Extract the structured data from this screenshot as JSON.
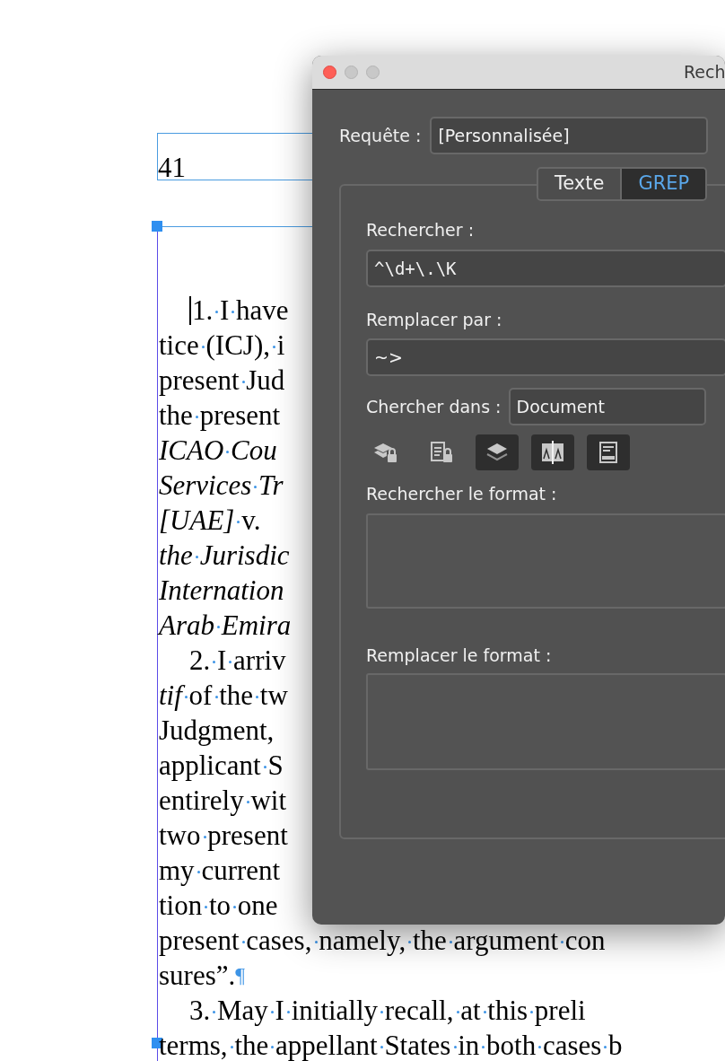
{
  "document": {
    "page_number": "41",
    "lines": [
      {
        "text": "1. I have",
        "indent": true,
        "italic": false,
        "cursor": true
      },
      {
        "text": "tice (ICJ), i",
        "indent": false,
        "italic": false
      },
      {
        "text": "present Jud",
        "indent": false,
        "italic": false
      },
      {
        "text": "the present",
        "indent": false,
        "italic": false
      },
      {
        "text": "ICAO Cou",
        "indent": false,
        "italic": true
      },
      {
        "text": "Services Tr",
        "indent": false,
        "italic": true
      },
      {
        "text": "*[UAE]* v.",
        "indent": false,
        "italic": false
      },
      {
        "text": "the Jurisdic",
        "indent": false,
        "italic": true
      },
      {
        "text": "Internation",
        "indent": false,
        "italic": true
      },
      {
        "text": "Arab Emira",
        "indent": false,
        "italic": true
      },
      {
        "text": "2. I arriv",
        "indent": true,
        "italic": false
      },
      {
        "text": "*tif* of the tw",
        "indent": false,
        "italic": false
      },
      {
        "text": "Judgment,",
        "indent": false,
        "italic": false
      },
      {
        "text": "applicant S",
        "indent": false,
        "italic": false
      },
      {
        "text": "entirely wit",
        "indent": false,
        "italic": false
      },
      {
        "text": "two present",
        "indent": false,
        "italic": false
      },
      {
        "text": "my current",
        "indent": false,
        "italic": false
      },
      {
        "text": "tion to one",
        "indent": false,
        "italic": false
      },
      {
        "text": "present cases, namely, the argument con",
        "indent": false,
        "italic": false
      },
      {
        "text": "sures”.",
        "indent": false,
        "italic": false,
        "end_mark": "¶"
      },
      {
        "text": "3. May I initially recall, at this preli",
        "indent": true,
        "italic": false
      },
      {
        "text": "terms, the appellant States in both cases b",
        "indent": false,
        "italic": false
      }
    ]
  },
  "dialog": {
    "title": "Rech",
    "query_label": "Requête :",
    "query_value": "[Personnalisée]",
    "tabs": [
      {
        "label": "Texte",
        "selected": false
      },
      {
        "label": "GREP",
        "selected": true
      }
    ],
    "find_label": "Rechercher :",
    "find_value": "^\\d+\\.\\K",
    "replace_label": "Remplacer par :",
    "replace_value": "~>",
    "search_in_label": "Chercher dans :",
    "search_in_value": "Document",
    "options": [
      {
        "kind": "locked-layers",
        "on": false
      },
      {
        "kind": "locked-stories",
        "on": false
      },
      {
        "kind": "hidden-layers",
        "on": true
      },
      {
        "kind": "master-pages",
        "on": true
      },
      {
        "kind": "footnotes",
        "on": true
      }
    ],
    "find_format_label": "Rechercher le format :",
    "replace_format_label": "Remplacer le format :"
  }
}
